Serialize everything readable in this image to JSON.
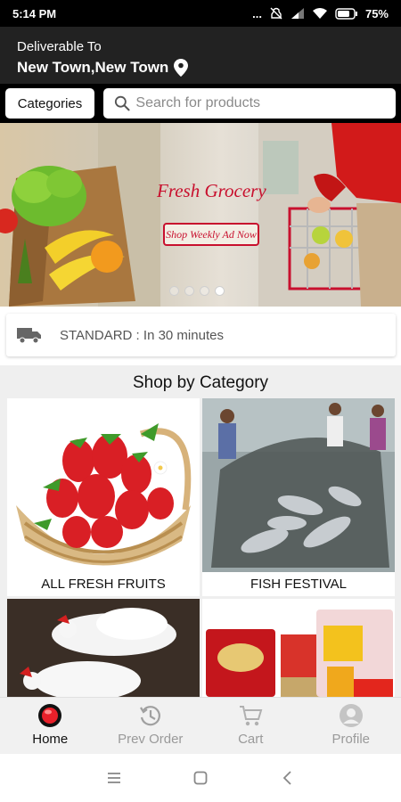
{
  "status_bar": {
    "time": "5:14 PM",
    "more": "...",
    "battery": "75%"
  },
  "header": {
    "deliver_label": "Deliverable To",
    "location": "New Town,New Town",
    "location_icon": "location-pin-icon"
  },
  "search": {
    "categories_label": "Categories",
    "placeholder": "Search for products"
  },
  "banner": {
    "title": "Fresh Grocery",
    "button_label": "Shop Weekly Ad Now",
    "slide_count": 4,
    "active_slide": 4
  },
  "delivery": {
    "icon": "truck-icon",
    "text": "STANDARD : In 30 minutes"
  },
  "categories": {
    "title": "Shop by Category",
    "items": [
      {
        "label": "ALL FRESH FRUITS"
      },
      {
        "label": "FISH FESTIVAL"
      },
      {
        "label": ""
      },
      {
        "label": ""
      }
    ]
  },
  "bottom_nav": {
    "items": [
      {
        "label": "Home",
        "icon": "home-icon",
        "active": true
      },
      {
        "label": "Prev Order",
        "icon": "history-icon",
        "active": false
      },
      {
        "label": "Cart",
        "icon": "cart-icon",
        "active": false
      },
      {
        "label": "Profile",
        "icon": "profile-icon",
        "active": false
      }
    ]
  },
  "colors": {
    "header_bg": "#222222",
    "accent_red": "#c8102e",
    "nav_bg": "#f1f1f1"
  }
}
